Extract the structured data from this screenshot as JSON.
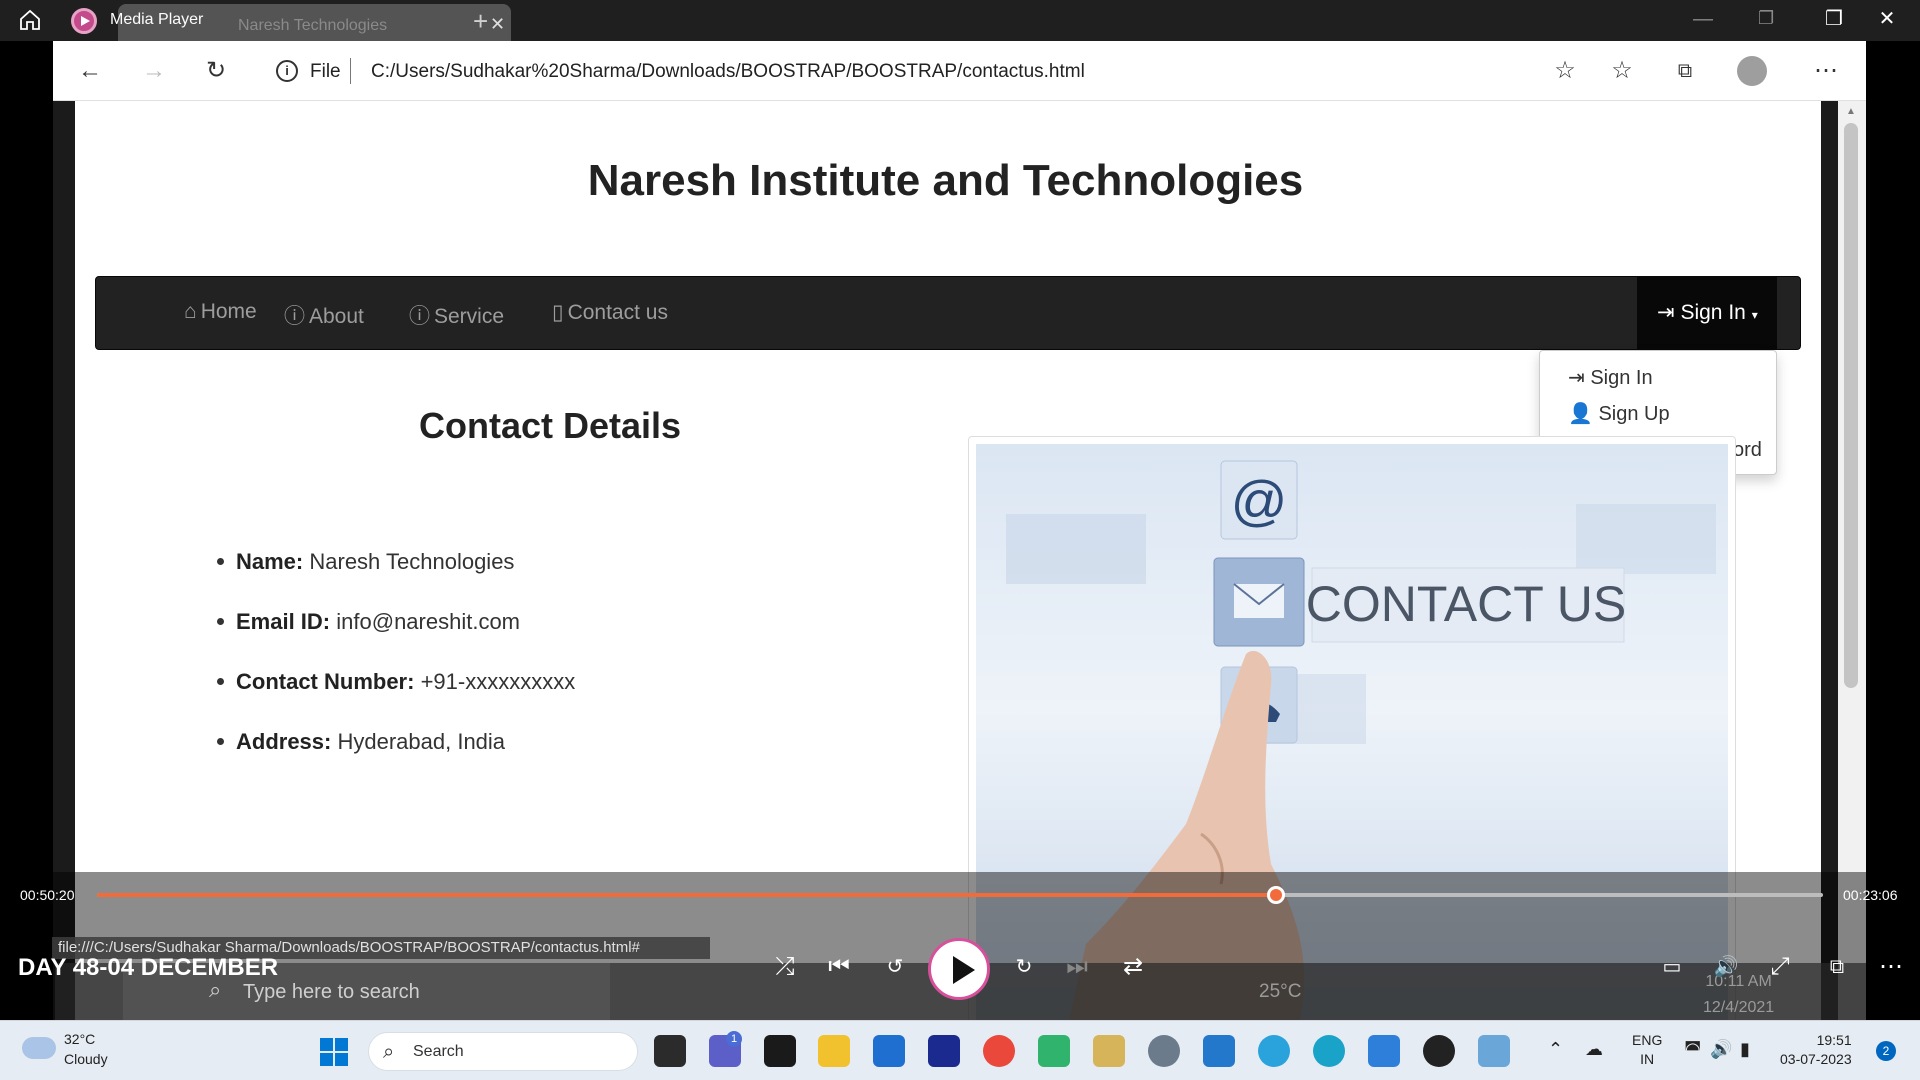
{
  "media_player": {
    "title": "Media Player",
    "time_elapsed": "00:50:20",
    "time_remaining": "00:23:06",
    "progress_fraction": 0.683,
    "video_title": "DAY 48-04 DECEMBER",
    "accent_color": "#f26b3a"
  },
  "browser": {
    "tab_title": "Naresh Technologies",
    "address_scheme": "File",
    "address_url": "C:/Users/Sudhakar%20Sharma/Downloads/BOOSTRAP/BOOSTRAP/contactus.html",
    "status_url": "file:///C:/Users/Sudhakar Sharma/Downloads/BOOSTRAP/BOOSTRAP/contactus.html#"
  },
  "page": {
    "site_title": "Naresh Institute and Technologies",
    "nav": [
      {
        "label": "Home",
        "icon": "home-icon"
      },
      {
        "label": "About",
        "icon": "question-circle-icon"
      },
      {
        "label": "Service",
        "icon": "question-circle-icon"
      },
      {
        "label": "Contact us",
        "icon": "phone-icon"
      }
    ],
    "sign_in_label": "Sign In",
    "dropdown": [
      {
        "label": "Sign In",
        "icon": "login-icon"
      },
      {
        "label": "Sign Up",
        "icon": "user-add-icon"
      },
      {
        "label": "Change Password",
        "icon": "lock-icon"
      }
    ],
    "contact_title": "Contact Details",
    "details": [
      {
        "label": "Name:",
        "value": "Naresh Technologies"
      },
      {
        "label": "Email ID:",
        "value": "info@nareshit.com"
      },
      {
        "label": "Contact Number:",
        "value": "+91-xxxxxxxxxx"
      },
      {
        "label": "Address:",
        "value": "Hyderabad, India"
      }
    ],
    "image_text": "CONTACT US",
    "image_at": "@"
  },
  "inner_taskbar": {
    "search_placeholder": "Type here to search",
    "temperature": "25°C",
    "time": "10:11 AM",
    "date": "12/4/2021"
  },
  "taskbar": {
    "weather_temp": "32°C",
    "weather_cond": "Cloudy",
    "search_label": "Search",
    "lang_line1": "ENG",
    "lang_line2": "IN",
    "time": "19:51",
    "date": "03-07-2023",
    "notification_count": "2",
    "teams_badge": "1"
  }
}
